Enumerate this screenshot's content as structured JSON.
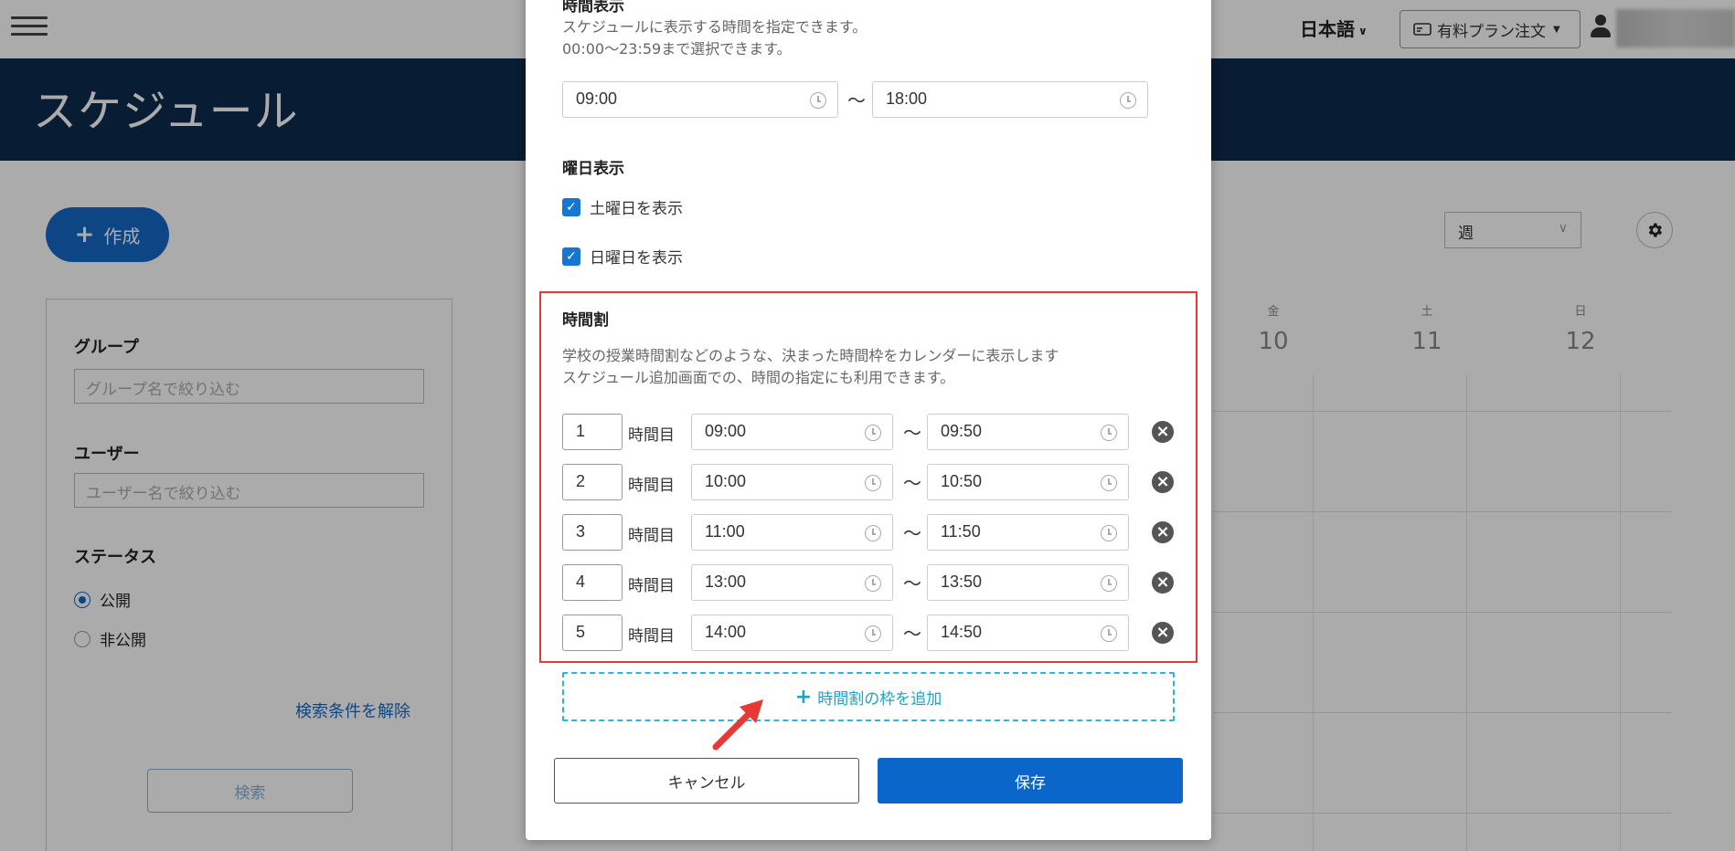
{
  "header": {
    "language": "日本語",
    "plan_button": "有料プラン注文"
  },
  "page": {
    "title": "スケジュール",
    "create_button": "作成"
  },
  "filters": {
    "group_label": "グループ",
    "group_placeholder": "グループ名で絞り込む",
    "user_label": "ユーザー",
    "user_placeholder": "ユーザー名で絞り込む",
    "status_label": "ステータス",
    "status_options": [
      "公開",
      "非公開"
    ],
    "status_selected": "公開",
    "clear_link": "検索条件を解除",
    "search_button": "検索"
  },
  "calendar": {
    "view": "週",
    "days": [
      {
        "dow": "金",
        "num": "10"
      },
      {
        "dow": "土",
        "num": "11"
      },
      {
        "dow": "日",
        "num": "12"
      }
    ]
  },
  "modal": {
    "time_display": {
      "title": "時間表示",
      "help_line1": "スケジュールに表示する時間を指定できます。",
      "help_line2": "00:00〜23:59まで選択できます。",
      "start": "09:00",
      "end": "18:00",
      "separator": "〜"
    },
    "weekday_display": {
      "title": "曜日表示",
      "show_saturday": "土曜日を表示",
      "show_sunday": "日曜日を表示",
      "saturday_checked": true,
      "sunday_checked": true
    },
    "timetable": {
      "title": "時間割",
      "help_line1": "学校の授業時間割などのような、決まった時間枠をカレンダーに表示します",
      "help_line2": "スケジュール追加画面での、時間の指定にも利用できます。",
      "period_suffix": "時間目",
      "separator": "〜",
      "rows": [
        {
          "num": "1",
          "start": "09:00",
          "end": "09:50"
        },
        {
          "num": "2",
          "start": "10:00",
          "end": "10:50"
        },
        {
          "num": "3",
          "start": "11:00",
          "end": "11:50"
        },
        {
          "num": "4",
          "start": "13:00",
          "end": "13:50"
        },
        {
          "num": "5",
          "start": "14:00",
          "end": "14:50"
        }
      ],
      "add_slot": "時間割の枠を追加"
    },
    "cancel_button": "キャンセル",
    "save_button": "保存"
  },
  "colors": {
    "navy": "#0d2a4d",
    "primary": "#0a66c8",
    "highlight": "#e53935",
    "dashed": "#29b6d8"
  }
}
